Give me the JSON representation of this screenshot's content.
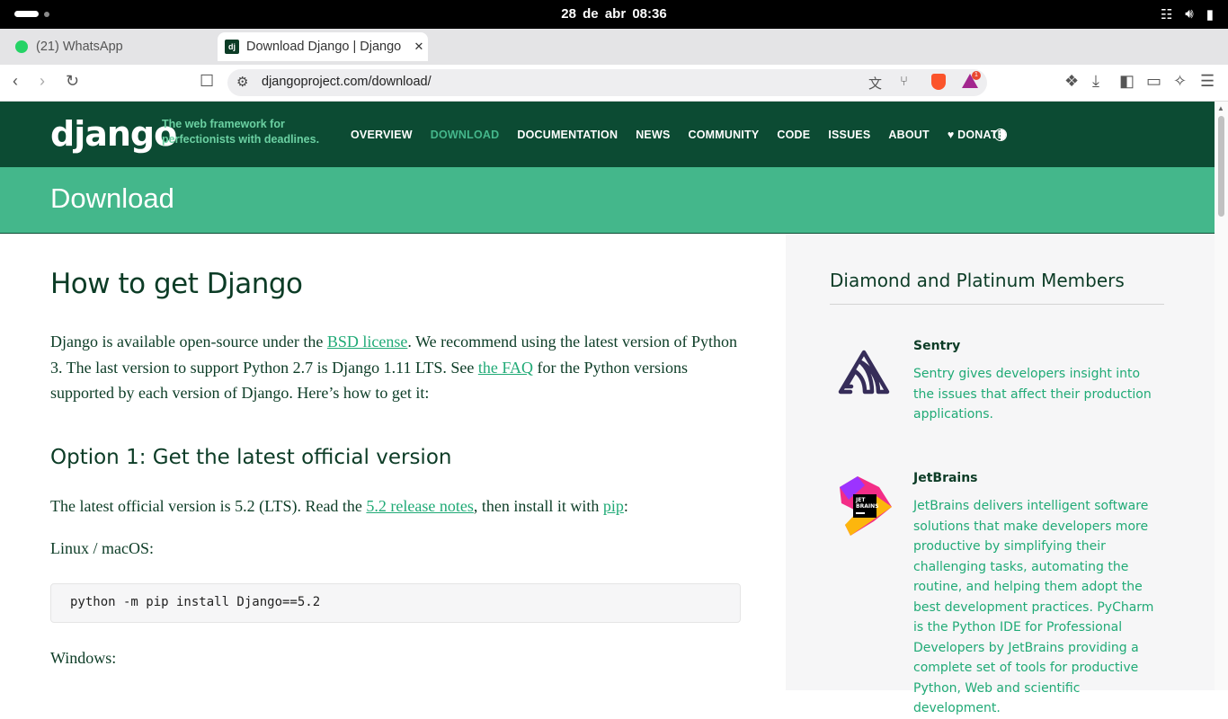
{
  "system_bar": {
    "datetime": "28 de abr  08:36",
    "icons": [
      "network-icon",
      "volume-icon",
      "battery-icon"
    ]
  },
  "browser": {
    "tabs": [
      {
        "label": "(21) WhatsApp",
        "icon": "whatsapp-icon",
        "active": false
      },
      {
        "label": "Download Django | Django",
        "icon": "django-favicon",
        "active": true
      }
    ],
    "url": "djangoproject.com/download/",
    "new_tab_symbol": "+",
    "rewards_badge": "1"
  },
  "site": {
    "logo": "django",
    "tagline": "The web framework for perfectionists with deadlines.",
    "nav": [
      "OVERVIEW",
      "DOWNLOAD",
      "DOCUMENTATION",
      "NEWS",
      "COMMUNITY",
      "CODE",
      "ISSUES",
      "ABOUT",
      "♥ DONATE"
    ],
    "active_nav": "DOWNLOAD",
    "page_title": "Download",
    "colors": {
      "header": "#0c4b33",
      "accent": "#44b78b",
      "link": "#20aa76"
    }
  },
  "content": {
    "heading": "How to get Django",
    "intro": {
      "t1": "Django is available open-source under the ",
      "link1": "BSD license",
      "t2": ". We recommend using the latest version of Python 3. The last version to support Python 2.7 is Django 1.11 LTS. See ",
      "link2": "the FAQ",
      "t3": " for the Python versions supported by each version of Django. Here’s how to get it:"
    },
    "option1_heading": "Option 1: Get the latest official version",
    "option1_text": {
      "t1": "The latest official version is 5.2 (LTS). Read the ",
      "link1": "5.2 release notes",
      "t2": ", then install it with ",
      "link2": "pip",
      "t3": ":"
    },
    "linux_label": "Linux / macOS:",
    "linux_command": "python -m pip install Django==5.2",
    "windows_label": "Windows:"
  },
  "sidebar": {
    "heading": "Diamond and Platinum Members",
    "members": [
      {
        "name": "Sentry",
        "description": "Sentry gives developers insight into the issues that affect their production applications."
      },
      {
        "name": "JetBrains",
        "description": "JetBrains delivers intelligent software solutions that make developers more productive by simplifying their challenging tasks, automating the routine, and helping them adopt the best development practices. PyCharm is the Python IDE for Professional Developers by JetBrains providing a complete set of tools for productive Python, Web and scientific development."
      }
    ]
  }
}
